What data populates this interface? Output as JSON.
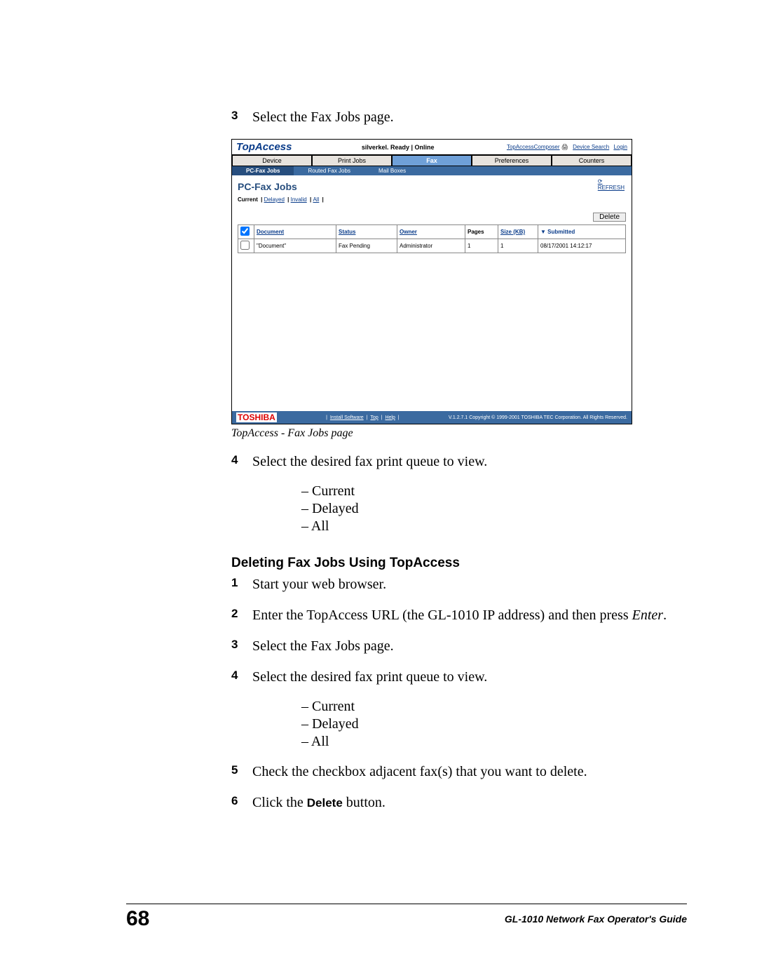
{
  "steps_top": {
    "s3": {
      "num": "3",
      "text": "Select the Fax Jobs page."
    }
  },
  "screenshot": {
    "brand": "TopAccess",
    "status": "silverkel. Ready | Online",
    "toplinks": {
      "composer": "TopAccessComposer",
      "search": "Device Search",
      "login": "Login"
    },
    "tabs": [
      "Device",
      "Print Jobs",
      "Fax",
      "Preferences",
      "Counters"
    ],
    "active_tab": 2,
    "subtabs": [
      "PC-Fax Jobs",
      "Routed Fax Jobs",
      "Mail Boxes"
    ],
    "active_subtab": 0,
    "panel_title": "PC-Fax Jobs",
    "refresh": "REFRESH",
    "filters": {
      "label": "Current",
      "links": [
        "Delayed",
        "Invalid",
        "All"
      ]
    },
    "delete_btn": "Delete",
    "columns": [
      "",
      "Document",
      "Status",
      "Owner",
      "Pages",
      "Size (KB)",
      "Submitted"
    ],
    "sort_col": "Submitted",
    "row": {
      "doc": "\"Document\"",
      "status": "Fax Pending",
      "owner": "Administrator",
      "pages": "1",
      "size": "1",
      "submitted": "08/17/2001 14:12:17"
    },
    "foot_brand": "TOSHIBA",
    "foot_links": [
      "Install Software",
      "Top",
      "Help"
    ],
    "foot_copy": "V.1.2.7.1 Copyright © 1999-2001 TOSHIBA TEC Corporation. All Rights Reserved."
  },
  "caption": "TopAccess - Fax Jobs page",
  "step4": {
    "num": "4",
    "text": "Select the desired fax print queue to view."
  },
  "bullets1": [
    "Current",
    "Delayed",
    "All"
  ],
  "section_heading": "Deleting Fax Jobs Using TopAccess",
  "d_steps": {
    "s1": {
      "num": "1",
      "text": "Start your web browser."
    },
    "s2": {
      "num": "2",
      "text_a": "Enter the TopAccess URL (the GL-1010 IP address) and then press ",
      "italic": "Enter",
      "text_b": "."
    },
    "s3": {
      "num": "3",
      "text": "Select the Fax Jobs page."
    },
    "s4": {
      "num": "4",
      "text": "Select the desired fax print queue to view."
    },
    "s5": {
      "num": "5",
      "text": "Check the checkbox adjacent fax(s) that you want to delete."
    },
    "s6": {
      "num": "6",
      "text_a": "Click the ",
      "bold": "Delete",
      "text_b": " button."
    }
  },
  "bullets2": [
    "Current",
    "Delayed",
    "All"
  ],
  "footer": {
    "page": "68",
    "guide": "GL-1010 Network Fax Operator's Guide"
  }
}
